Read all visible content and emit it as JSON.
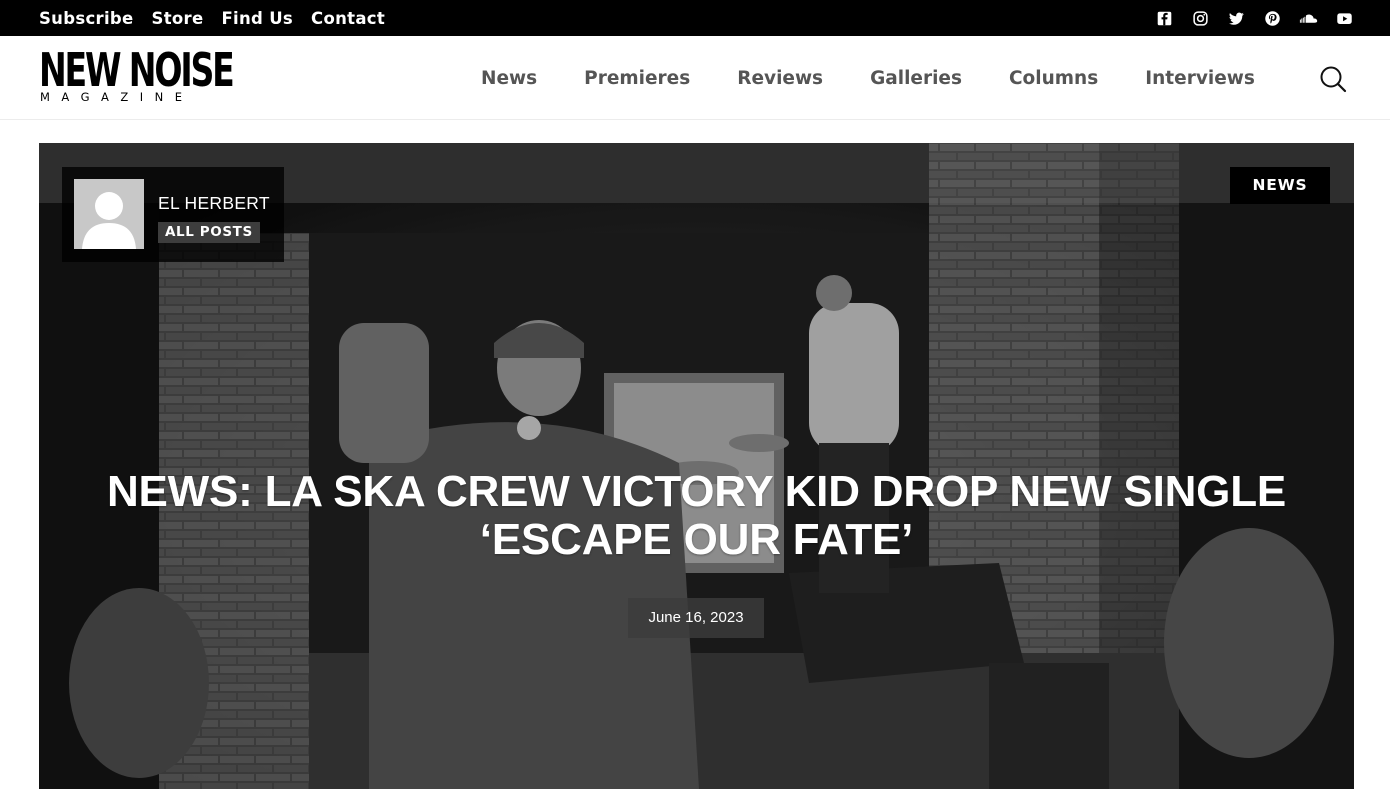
{
  "topbar": {
    "links": [
      "Subscribe",
      "Store",
      "Find Us",
      "Contact"
    ],
    "social_icons": [
      "facebook-icon",
      "instagram-icon",
      "twitter-icon",
      "pinterest-icon",
      "soundcloud-icon",
      "youtube-icon"
    ]
  },
  "header": {
    "logo_line1": "NEW NOISE",
    "logo_line2": "MAGAZINE",
    "nav": [
      "News",
      "Premieres",
      "Reviews",
      "Galleries",
      "Columns",
      "Interviews"
    ],
    "search_icon": "search-icon"
  },
  "hero": {
    "author": {
      "name": "EL HERBERT",
      "all_posts_label": "ALL POSTS"
    },
    "category": "NEWS",
    "title": "NEWS: LA SKA CREW VICTORY KID DROP NEW SINGLE ‘ESCAPE OUR FATE’",
    "date": "June 16, 2023"
  },
  "colors": {
    "topbar_bg": "#000000",
    "nav_text": "#555555",
    "badge_bg": "#000000"
  }
}
